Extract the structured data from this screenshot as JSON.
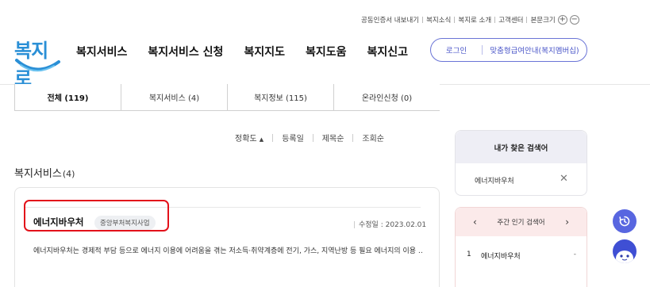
{
  "utility": {
    "items": [
      "공동인증서 내보내기",
      "복지소식",
      "복지로 소개",
      "고객센터",
      "본문크기"
    ],
    "zoom_in": "+",
    "zoom_out": "−"
  },
  "logo": {
    "text": "복지로",
    "icon": "smile-arc-logo"
  },
  "gnb": [
    "복지서비스",
    "복지서비스 신청",
    "복지지도",
    "복지도움",
    "복지신고"
  ],
  "auth": {
    "login": "로그인",
    "guide": "맞춤형급여안내(복지멤버십)"
  },
  "tabs": [
    {
      "label": "전체 (119)",
      "active": true
    },
    {
      "label": "복지서비스 (4)",
      "active": false
    },
    {
      "label": "복지정보 (115)",
      "active": false
    },
    {
      "label": "온라인신청 (0)",
      "active": false
    }
  ],
  "sort": {
    "options": [
      "정확도",
      "등록일",
      "제목순",
      "조회순"
    ],
    "active_arrow": "▲"
  },
  "section": {
    "title": "복지서비스",
    "count": "(4)"
  },
  "result": {
    "name": "에너지바우처",
    "badge": "중앙부처복지사업",
    "date_label": "수정일 : 2023.02.01",
    "description": "에너지바우처는 경제적 부담 등으로 에너지 이용에 어려움을 겪는 저소득·취약계층에 전기, 가스, 지역난방 등 필요 에너지의 이용 …",
    "highlight_color": "#e3111a"
  },
  "my_search": {
    "title": "내가 찾은 검색어",
    "items": [
      "에너지바우처"
    ],
    "remove_icon": "close-icon"
  },
  "popular": {
    "title": "주간 인기 검색어",
    "prev_icon": "‹",
    "next_icon": "›",
    "items": [
      {
        "rank": "1",
        "label": "에너지바우처",
        "change": "-"
      }
    ]
  },
  "colors": {
    "brand": "#2a8fd6",
    "accent": "#5866e0",
    "highlight": "#e3111a"
  }
}
